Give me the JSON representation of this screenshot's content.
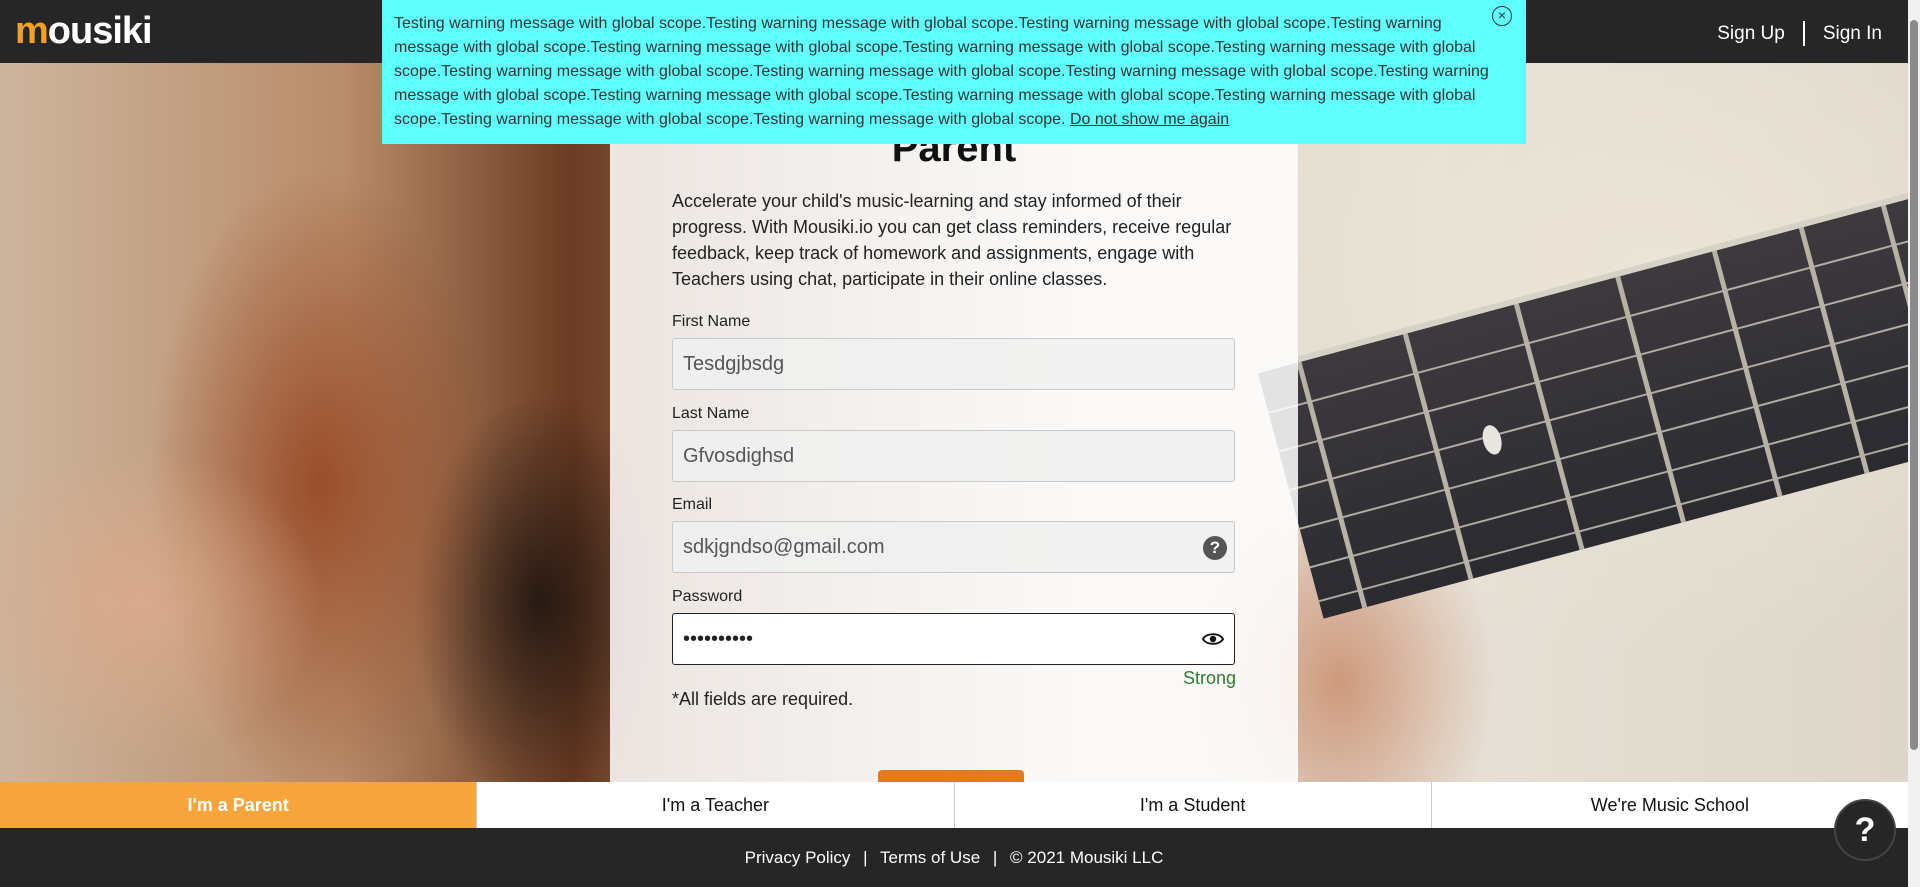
{
  "header": {
    "logo_text_accent": "m",
    "logo_text_rest": "ousiki",
    "sign_up_label": "Sign Up",
    "sign_in_label": "Sign In"
  },
  "warning": {
    "message": "Testing warning message with global scope.Testing warning message with global scope.Testing warning message with global scope.Testing warning message with global scope.Testing warning message with global scope.Testing warning message with global scope.Testing warning message with global scope.Testing warning message with global scope.Testing warning message with global scope.Testing warning message with global scope.Testing warning message with global scope.Testing warning message with global scope.Testing warning message with global scope.Testing warning message with global scope.Testing warning message with global scope.Testing warning message with global scope.",
    "dismiss_label": "Do not show me again",
    "close_icon": "close-icon"
  },
  "form": {
    "title": "Parent",
    "intro": "Accelerate your child's music-learning and stay informed of their progress. With Mousiki.io you can get class reminders, receive regular feedback, keep track of homework and assignments, engage with Teachers using chat, participate in their online classes.",
    "first_name": {
      "label": "First Name",
      "value": "Tesdgjbsdg"
    },
    "last_name": {
      "label": "Last Name",
      "value": "Gfvosdighsd"
    },
    "email": {
      "label": "Email",
      "value": "sdkjgndso@gmail.com"
    },
    "password": {
      "label": "Password",
      "value": "••••••••••",
      "strength": "Strong"
    },
    "required_note": "*All fields are required."
  },
  "tabs": [
    {
      "label": "I'm a Parent",
      "active": true
    },
    {
      "label": "I'm a Teacher",
      "active": false
    },
    {
      "label": "I'm a Student",
      "active": false
    },
    {
      "label": "We're Music School",
      "active": false
    }
  ],
  "footer": {
    "privacy": "Privacy Policy",
    "terms": "Terms of Use",
    "copyright": "© 2021 Mousiki LLC"
  },
  "help_button_label": "?",
  "colors": {
    "brand_orange": "#f6a43c",
    "warning_bg": "#5ffffd",
    "dark_bg": "#262626",
    "strength_green": "#2e7d32"
  }
}
